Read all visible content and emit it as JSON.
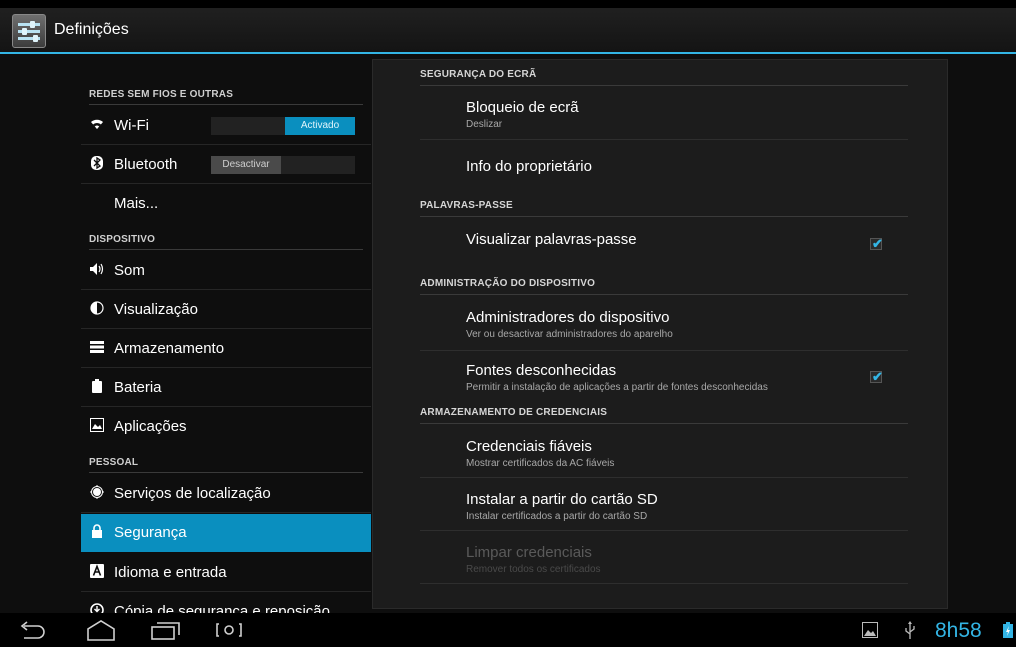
{
  "app": {
    "title": "Definições",
    "icon": "settings-icon",
    "accent": "#33b5e5"
  },
  "left": {
    "sections": [
      {
        "header": "REDES SEM FIOS E OUTRAS"
      },
      {
        "header": "DISPOSITIVO"
      },
      {
        "header": "PESSOAL"
      }
    ],
    "items": [
      {
        "label": "Wi-Fi",
        "icon": "wifi-icon",
        "toggle": "Activado"
      },
      {
        "label": "Bluetooth",
        "icon": "bluetooth-icon",
        "toggle": "Desactivar"
      },
      {
        "label": "Mais..."
      },
      {
        "label": "Som",
        "icon": "sound-icon"
      },
      {
        "label": "Visualização",
        "icon": "display-icon"
      },
      {
        "label": "Armazenamento",
        "icon": "storage-icon"
      },
      {
        "label": "Bateria",
        "icon": "battery-icon"
      },
      {
        "label": "Aplicações",
        "icon": "apps-icon"
      },
      {
        "label": "Serviços de localização",
        "icon": "location-icon"
      },
      {
        "label": "Segurança",
        "icon": "lock-icon",
        "selected": true
      },
      {
        "label": "Idioma e entrada",
        "icon": "language-icon"
      },
      {
        "label": "Cópia de segurança e reposição",
        "icon": "backup-icon"
      }
    ]
  },
  "right": {
    "sections": [
      {
        "header": "SEGURANÇA DO ECRÃ"
      },
      {
        "header": "PALAVRAS-PASSE"
      },
      {
        "header": "ADMINISTRAÇÃO DO DISPOSITIVO"
      },
      {
        "header": "ARMAZENAMENTO DE CREDENCIAIS"
      }
    ],
    "items": [
      {
        "title": "Bloqueio de ecrã",
        "summary": "Deslizar"
      },
      {
        "title": "Info do proprietário"
      },
      {
        "title": "Visualizar palavras-passe",
        "checked": true
      },
      {
        "title": "Administradores do dispositivo",
        "summary": "Ver ou desactivar administradores do aparelho"
      },
      {
        "title": "Fontes desconhecidas",
        "summary": "Permitir a instalação de aplicações a partir de fontes desconhecidas",
        "checked": true
      },
      {
        "title": "Credenciais fiáveis",
        "summary": "Mostrar certificados da AC fiáveis"
      },
      {
        "title": "Instalar a partir do cartão SD",
        "summary": "Instalar certificados a partir do cartão SD"
      },
      {
        "title": "Limpar credenciais",
        "summary": "Remover todos os certificados",
        "disabled": true
      }
    ]
  },
  "navbar": {
    "buttons": [
      "back-icon",
      "home-icon",
      "recent-apps-icon",
      "screenshot-icon"
    ],
    "status_icons": [
      "gallery-icon",
      "usb-icon",
      "battery-charging-icon"
    ],
    "clock": "8h58"
  }
}
